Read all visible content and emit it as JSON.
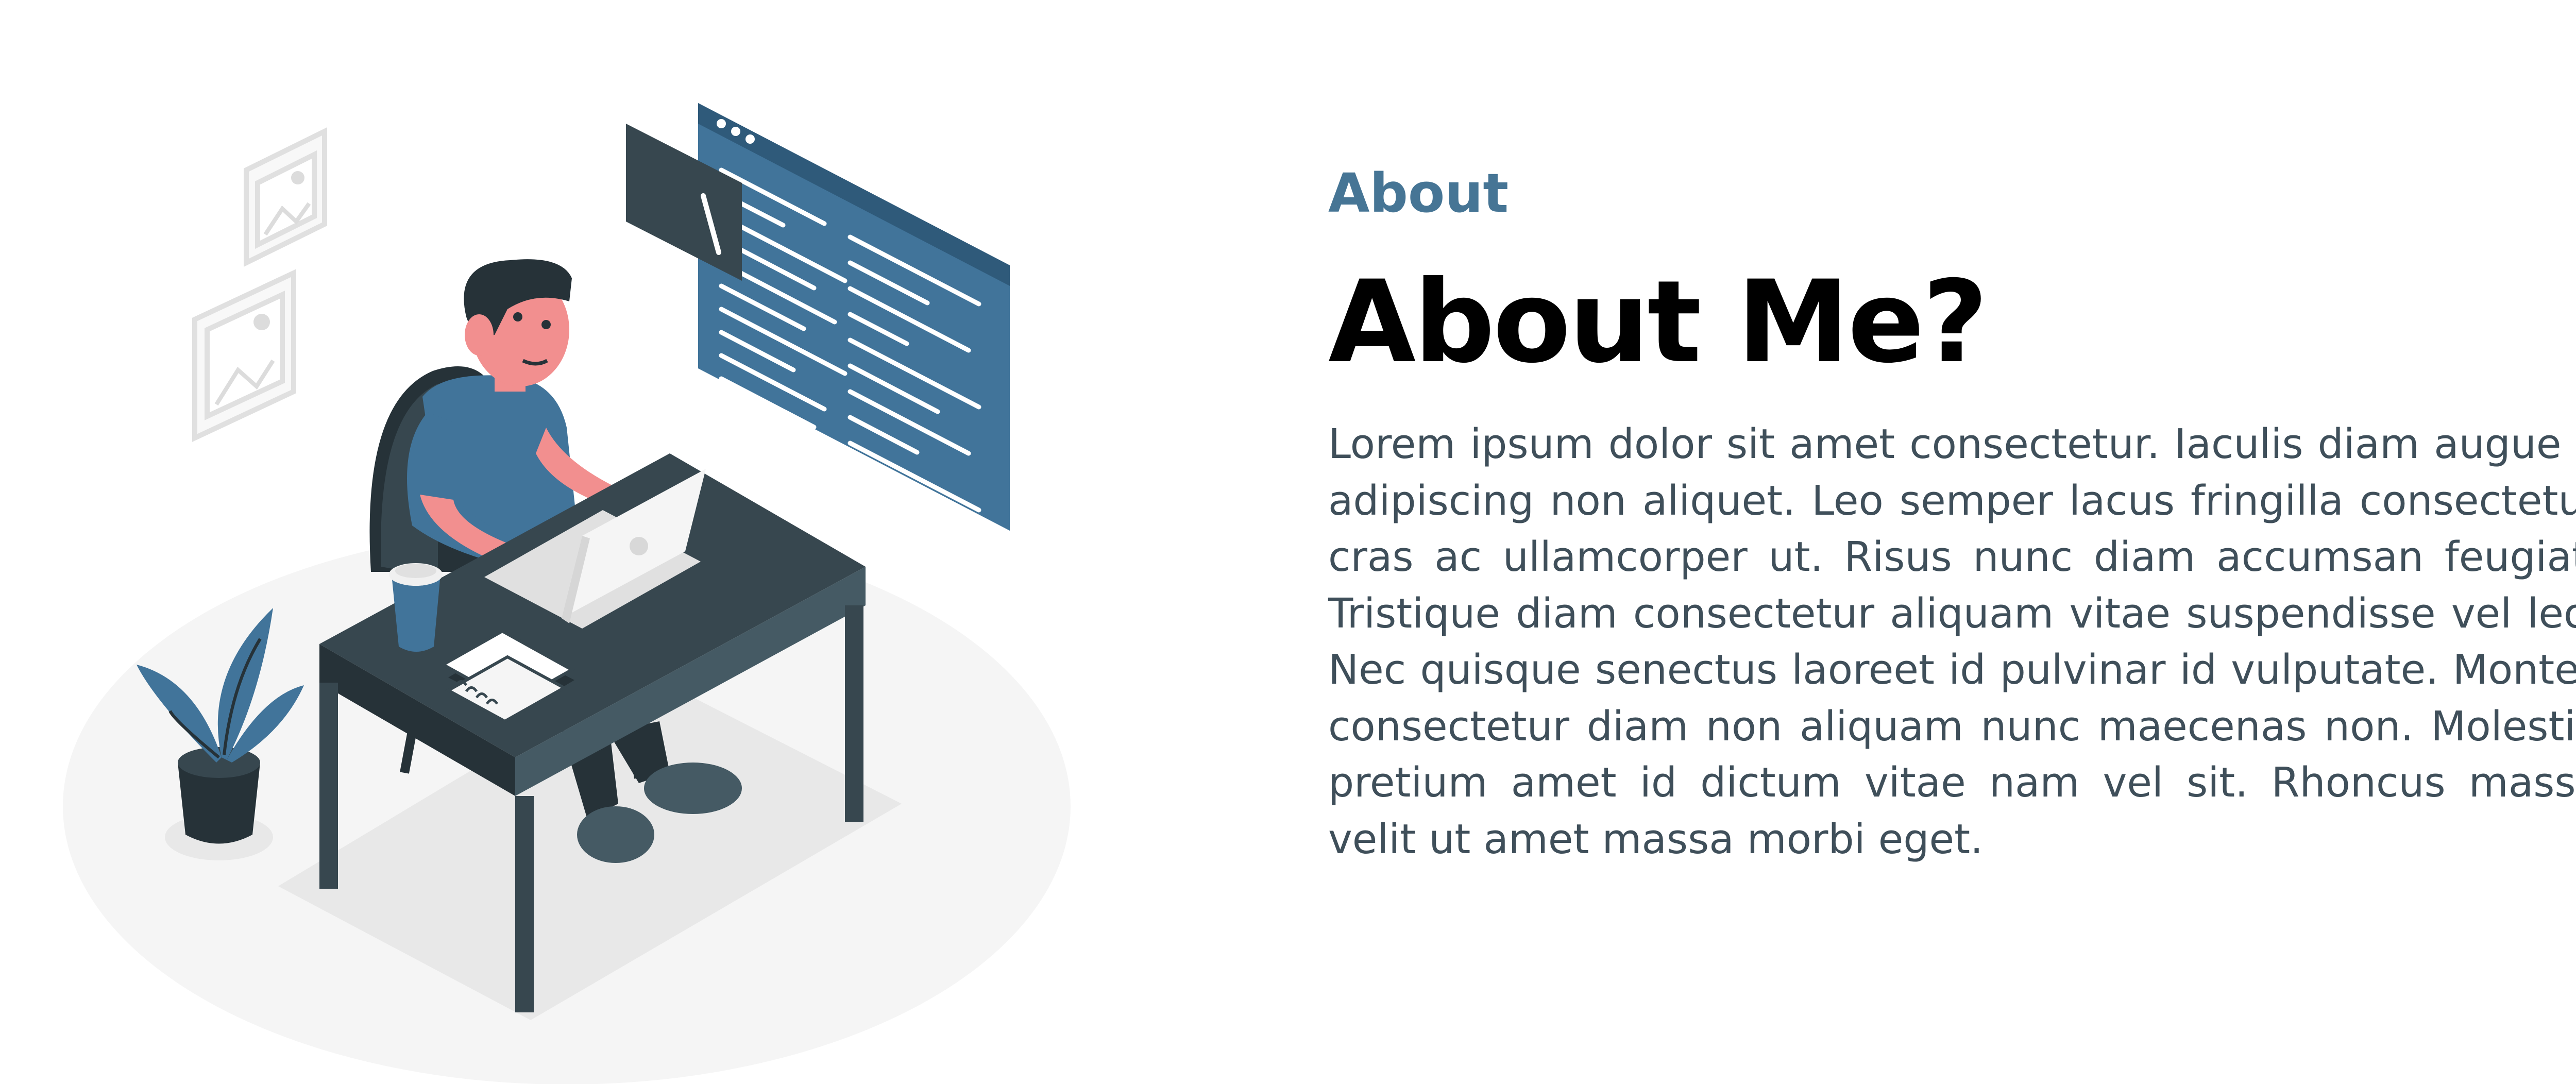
{
  "about": {
    "eyebrow": "About",
    "heading": "About Me?",
    "body": "Lorem ipsum dolor sit amet consectetur. Iaculis diam augue a adipiscing non aliquet. Leo semper lacus fringilla consectetur cras ac ullamcorper ut. Risus nunc diam accumsan feugiat. Tristique diam consectetur aliquam vitae suspendisse vel leo. Nec quisque senectus laoreet id pulvinar id vulputate. Montes consectetur diam non aliquam nunc maecenas non. Molestie pretium amet id dictum vitae nam vel sit. Rhoncus massa velit ut amet massa morbi eget."
  },
  "illustration": {
    "icon": "developer-at-desk-illustration"
  },
  "colors": {
    "accent": "#467595",
    "heading": "#000000",
    "body": "#3f4f5a",
    "illustration_dark": "#37474f",
    "illustration_blue": "#41749a",
    "skin": "#f28f8f"
  }
}
